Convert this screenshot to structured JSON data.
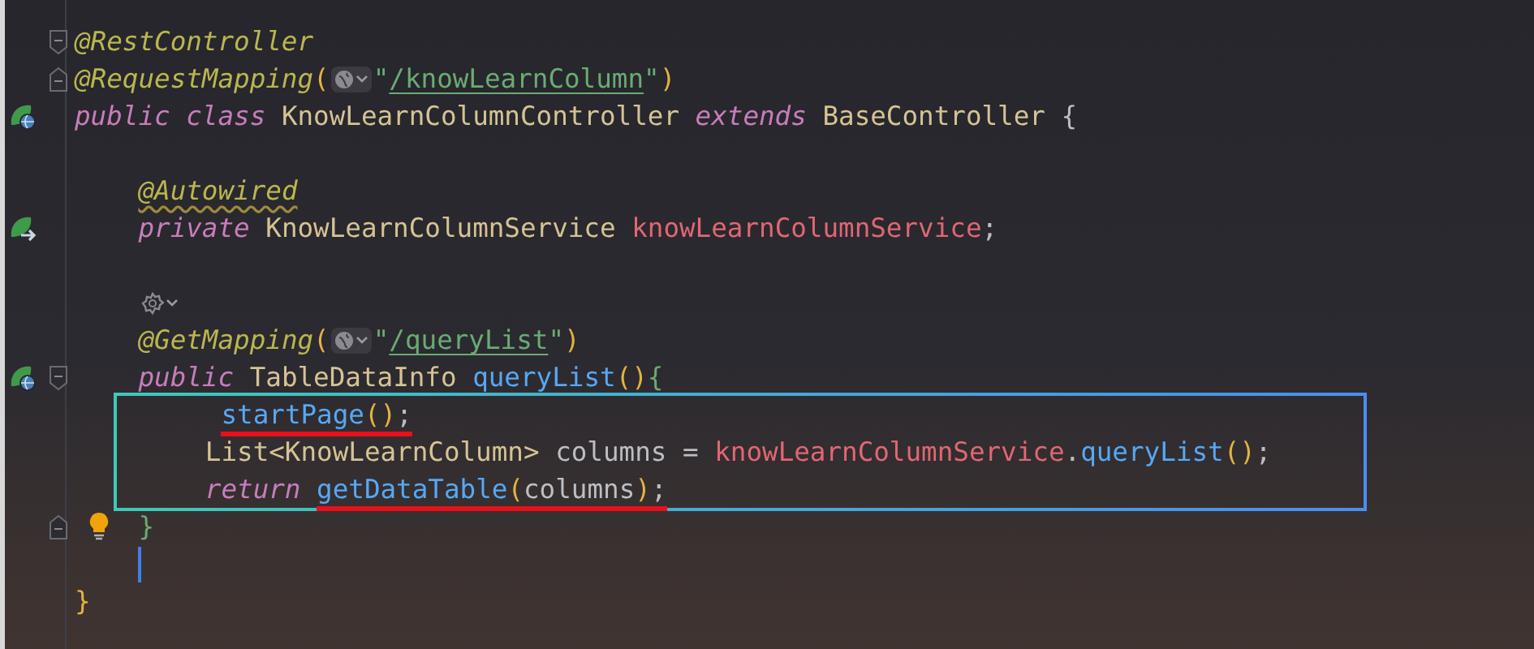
{
  "editor": {
    "lines": [
      {
        "kind": "code",
        "fold": {
          "kind": "start"
        },
        "tokens": [
          {
            "kind": "annotation",
            "text": "@RestController"
          }
        ]
      },
      {
        "kind": "code",
        "fold": {
          "kind": "end"
        },
        "tokens": [
          {
            "kind": "annotation",
            "text": "@RequestMapping"
          },
          {
            "kind": "paren",
            "text": "("
          },
          {
            "kind": "hint-globe"
          },
          {
            "kind": "string",
            "text": "\""
          },
          {
            "kind": "link",
            "text": "/knowLearnColumn"
          },
          {
            "kind": "string",
            "text": "\""
          },
          {
            "kind": "paren",
            "text": ")"
          }
        ]
      },
      {
        "kind": "code",
        "gutter": {
          "kind": "leaf-globe"
        },
        "tokens": [
          {
            "kind": "keyword",
            "text": "public class "
          },
          {
            "kind": "class",
            "text": "KnowLearnColumnController "
          },
          {
            "kind": "keyword",
            "text": "extends "
          },
          {
            "kind": "class",
            "text": "BaseController "
          },
          {
            "kind": "plain",
            "text": "{"
          }
        ]
      },
      {
        "kind": "blank"
      },
      {
        "kind": "code",
        "tokens": [
          {
            "kind": "annotation-warn",
            "text": "    @Autowired"
          }
        ]
      },
      {
        "kind": "code",
        "gutter": {
          "kind": "leaf-arrow"
        },
        "tokens": [
          {
            "kind": "keyword",
            "text": "    private "
          },
          {
            "kind": "class",
            "text": "KnowLearnColumnService "
          },
          {
            "kind": "field",
            "text": "knowLearnColumnService"
          },
          {
            "kind": "plain",
            "text": ";"
          }
        ]
      },
      {
        "kind": "blank"
      },
      {
        "kind": "code",
        "tokens": [
          {
            "kind": "hint-gear"
          }
        ]
      },
      {
        "kind": "code",
        "tokens": [
          {
            "kind": "annotation",
            "text": "    @GetMapping"
          },
          {
            "kind": "paren",
            "text": "("
          },
          {
            "kind": "hint-globe"
          },
          {
            "kind": "string",
            "text": "\""
          },
          {
            "kind": "link",
            "text": "/queryList"
          },
          {
            "kind": "string",
            "text": "\""
          },
          {
            "kind": "paren",
            "text": ")"
          }
        ]
      },
      {
        "kind": "code",
        "gutter": {
          "kind": "leaf-globe"
        },
        "fold": {
          "kind": "start"
        },
        "tokens": [
          {
            "kind": "keyword",
            "text": "    public "
          },
          {
            "kind": "class",
            "text": "TableDataInfo "
          },
          {
            "kind": "method",
            "text": "queryList"
          },
          {
            "kind": "paren",
            "text": "()"
          },
          {
            "kind": "brace",
            "text": "{"
          }
        ]
      },
      {
        "kind": "code",
        "boxed": true,
        "tokens": [
          {
            "kind": "method",
            "text": "         startPage",
            "marked": true
          },
          {
            "kind": "paren",
            "text": "()",
            "marked": true
          },
          {
            "kind": "plain",
            "text": ";",
            "marked": true
          }
        ]
      },
      {
        "kind": "code",
        "boxed": true,
        "tokens": [
          {
            "kind": "class",
            "text": "        List<KnowLearnColumn> "
          },
          {
            "kind": "plain",
            "text": "columns = "
          },
          {
            "kind": "field",
            "text": "knowLearnColumnService"
          },
          {
            "kind": "plain",
            "text": "."
          },
          {
            "kind": "method",
            "text": "queryList"
          },
          {
            "kind": "paren",
            "text": "()"
          },
          {
            "kind": "plain",
            "text": ";"
          }
        ]
      },
      {
        "kind": "code",
        "boxed": true,
        "tokens": [
          {
            "kind": "keyword",
            "text": "        return "
          },
          {
            "kind": "method",
            "text": "getDataTable",
            "marked": true
          },
          {
            "kind": "paren",
            "text": "(",
            "marked": true
          },
          {
            "kind": "plain",
            "text": "columns",
            "marked": true
          },
          {
            "kind": "paren",
            "text": ")",
            "marked": true
          },
          {
            "kind": "plain",
            "text": ";",
            "marked": true
          }
        ]
      },
      {
        "kind": "code",
        "fold": {
          "kind": "end"
        },
        "bulb": true,
        "tokens": [
          {
            "kind": "brace",
            "text": "    }"
          }
        ]
      },
      {
        "kind": "caret"
      },
      {
        "kind": "code",
        "tokens": [
          {
            "kind": "paren",
            "text": "}"
          }
        ]
      }
    ]
  }
}
